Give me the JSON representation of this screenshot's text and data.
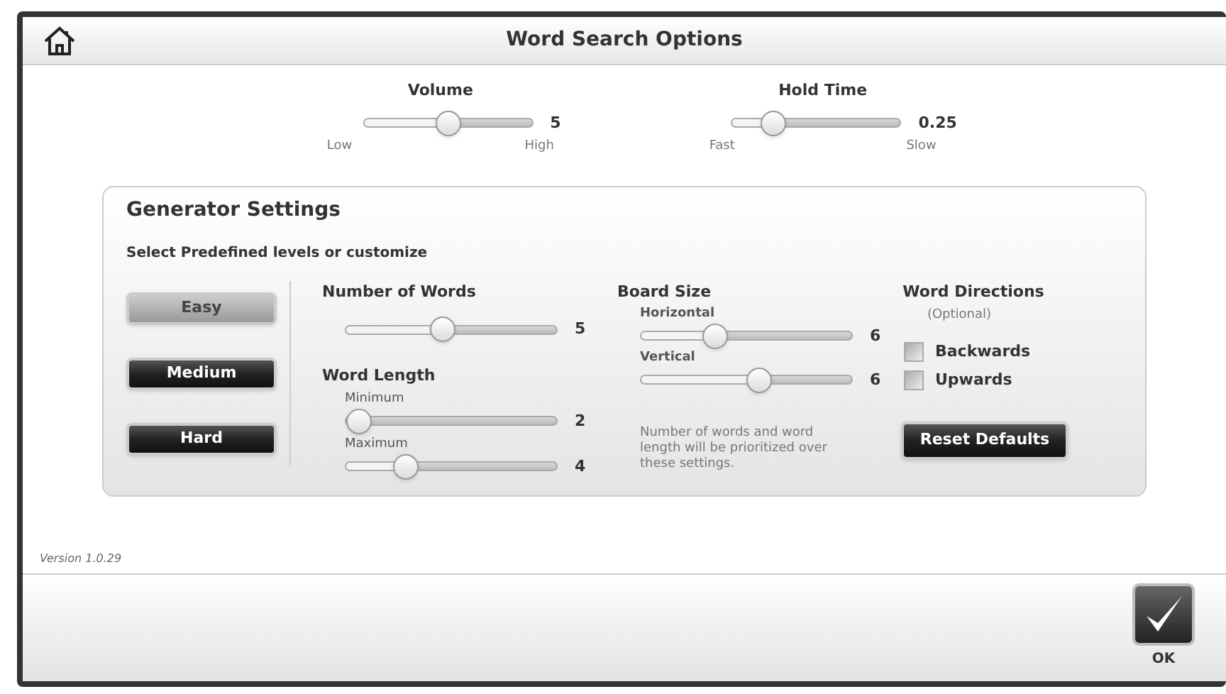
{
  "header": {
    "title": "Word Search Options"
  },
  "top_sliders": [
    {
      "label": "Volume",
      "level": 0.5,
      "reading": "5",
      "min_label": "Low",
      "max_label": "High"
    },
    {
      "label": "Hold Time",
      "level": 0.2,
      "reading": "0.25",
      "min_label": "Fast",
      "max_label": "Slow"
    }
  ],
  "generator": {
    "title": "Generator Settings",
    "subtitle": "Select Predefined levels or customize",
    "levels": [
      {
        "label": "Easy",
        "selected": true
      },
      {
        "label": "Medium",
        "selected": false
      },
      {
        "label": "Hard",
        "selected": false
      }
    ],
    "number_of_words": {
      "label": "Number of Words",
      "level": 0.45,
      "reading": "5"
    },
    "word_length": {
      "label": "Word Length",
      "sliders": [
        {
          "label": "Minimum",
          "level": 0,
          "reading": "2"
        },
        {
          "label": "Maximum",
          "level": 0.25,
          "reading": "4"
        }
      ]
    },
    "board_size": {
      "label": "Board Size",
      "sliders": [
        {
          "label": "Horizontal",
          "level": 0.33,
          "reading": "6"
        },
        {
          "label": "Vertical",
          "level": 0.57,
          "reading": "6"
        }
      ],
      "note": "Number of words and word length will be prioritized over these settings."
    },
    "word_directions": {
      "label": "Word Directions",
      "hint": "(Optional)",
      "options": [
        {
          "label": "Backwards",
          "checked": false
        },
        {
          "label": "Upwards",
          "checked": false
        }
      ],
      "reset_button": "Reset Defaults"
    }
  },
  "version": "Version 1.0.29",
  "ok_button": {
    "label": "OK"
  }
}
